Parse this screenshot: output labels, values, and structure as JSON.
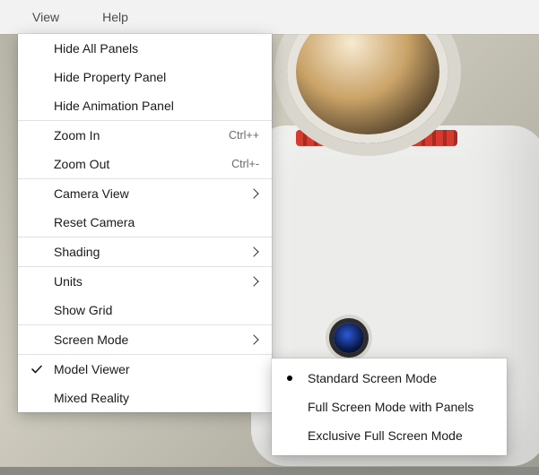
{
  "menubar": {
    "view": "View",
    "help": "Help"
  },
  "view_menu": {
    "hide_all_panels": "Hide All Panels",
    "hide_property_panel": "Hide Property Panel",
    "hide_animation_panel": "Hide Animation Panel",
    "zoom_in": {
      "label": "Zoom In",
      "shortcut": "Ctrl++"
    },
    "zoom_out": {
      "label": "Zoom Out",
      "shortcut": "Ctrl+-"
    },
    "camera_view": "Camera View",
    "reset_camera": "Reset Camera",
    "shading": "Shading",
    "units": "Units",
    "show_grid": "Show Grid",
    "screen_mode": "Screen Mode",
    "model_viewer": "Model Viewer",
    "mixed_reality": "Mixed Reality"
  },
  "screen_mode_submenu": {
    "standard": "Standard Screen Mode",
    "full_panels": "Full Screen Mode with Panels",
    "exclusive": "Exclusive Full Screen Mode",
    "selected": "standard"
  }
}
